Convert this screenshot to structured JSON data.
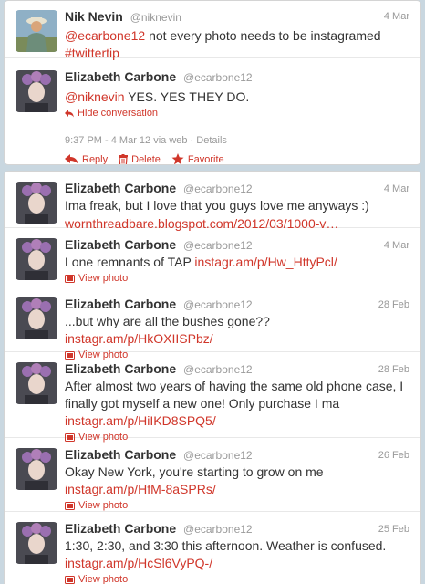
{
  "conversation": {
    "original": {
      "name": "Nik Nevin",
      "handle": "@niknevin",
      "date": "4 Mar",
      "mention": "@ecarbone12",
      "text": "not every photo needs to be instagramed",
      "hashtag": "#twittertip"
    },
    "reply": {
      "name": "Elizabeth Carbone",
      "handle": "@ecarbone12",
      "mention": "@niknevin",
      "text": "YES. YES THEY DO.",
      "hide_label": "Hide conversation",
      "meta": "9:37 PM - 4 Mar 12 via web · Details",
      "reply_label": "Reply",
      "delete_label": "Delete",
      "favorite_label": "Favorite"
    }
  },
  "timeline": [
    {
      "name": "Elizabeth Carbone",
      "handle": "@ecarbone12",
      "date": "4 Mar",
      "text": "Ima freak, but I love that you guys love me anyways :)",
      "link": "wornthreadbare.blogspot.com/2012/03/1000-v…"
    },
    {
      "name": "Elizabeth Carbone",
      "handle": "@ecarbone12",
      "date": "4 Mar",
      "text": "Lone remnants of TAP",
      "link": "instagr.am/p/Hw_HttyPcl/",
      "photo_label": "View photo"
    },
    {
      "name": "Elizabeth Carbone",
      "handle": "@ecarbone12",
      "date": "28 Feb",
      "text": "...but why are all the bushes gone??",
      "link": "instagr.am/p/HkOXIISPbz/",
      "photo_label": "View photo"
    },
    {
      "name": "Elizabeth Carbone",
      "handle": "@ecarbone12",
      "date": "28 Feb",
      "text": "After almost two years of having the same old phone case, I finally got myself a new one! Only purchase I ma",
      "link": "instagr.am/p/HiIKD8SPQ5/",
      "photo_label": "View photo"
    },
    {
      "name": "Elizabeth Carbone",
      "handle": "@ecarbone12",
      "date": "26 Feb",
      "text": "Okay New York, you're starting to grow on me",
      "link": "instagr.am/p/HfM-8aSPRs/",
      "photo_label": "View photo"
    },
    {
      "name": "Elizabeth Carbone",
      "handle": "@ecarbone12",
      "date": "25 Feb",
      "text": "1:30, 2:30, and 3:30 this afternoon. Weather is confused.",
      "link": "instagr.am/p/HcSl6VyPQ-/",
      "photo_label": "View photo"
    }
  ],
  "colors": {
    "link": "#d0362a",
    "background": "#c9d7e0",
    "muted": "#999999"
  }
}
